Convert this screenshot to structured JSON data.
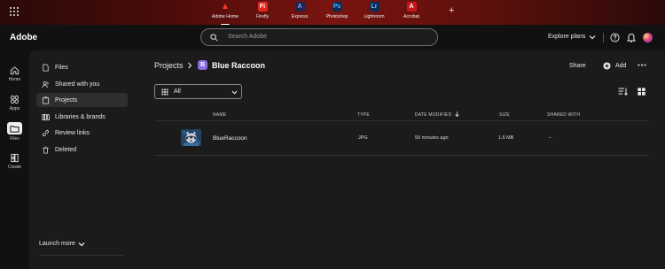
{
  "topbar": {
    "apps": [
      {
        "label": "Adobe Home",
        "glyph": "A",
        "color": "#e0271c",
        "active": true
      },
      {
        "label": "Firefly",
        "glyph": "Fi",
        "color": "#e0271c",
        "active": false
      },
      {
        "label": "Express",
        "glyph": "A",
        "color": "#2c2c6e",
        "active": false
      },
      {
        "label": "Photoshop",
        "glyph": "Ps",
        "color": "#0d2a4f",
        "active": false
      },
      {
        "label": "Lightroom",
        "glyph": "Lr",
        "color": "#0c2d55",
        "active": false
      },
      {
        "label": "Acrobat",
        "glyph": "A",
        "color": "#c8161b",
        "active": false
      }
    ],
    "add_app": "+"
  },
  "header": {
    "brand": "Adobe",
    "search_placeholder": "Search Adobe",
    "explore": "Explore plans"
  },
  "rail": [
    {
      "label": "Home",
      "icon": "home-icon"
    },
    {
      "label": "Apps",
      "icon": "apps-icon"
    },
    {
      "label": "Files",
      "icon": "folder-icon",
      "active": true
    },
    {
      "label": "Create",
      "icon": "create-icon"
    }
  ],
  "nav": {
    "items": [
      {
        "label": "Files",
        "icon": "file-icon"
      },
      {
        "label": "Shared with you",
        "icon": "shared-icon"
      },
      {
        "label": "Projects",
        "icon": "project-icon",
        "active": true
      },
      {
        "label": "Libraries & brands",
        "icon": "library-icon"
      },
      {
        "label": "Review links",
        "icon": "link-icon"
      },
      {
        "label": "Deleted",
        "icon": "trash-icon"
      }
    ],
    "launch_more": "Launch more"
  },
  "breadcrumb": {
    "parent": "Projects",
    "badge": "B",
    "title": "Blue Raccoon"
  },
  "actions": {
    "share": "Share",
    "add": "Add"
  },
  "filter": {
    "value": "All"
  },
  "table": {
    "columns": [
      "NAME",
      "TYPE",
      "DATE MODIFIED",
      "SIZE",
      "SHARED WITH"
    ],
    "rows": [
      {
        "name": "BlueRaccoon",
        "type": "JPG",
        "modified": "50 minutes ago",
        "size": "1.6 MB",
        "shared": "–"
      }
    ]
  },
  "colors": {
    "accent_badge": "#8a6ee0",
    "panel": "#1b1b1b",
    "background": "#111111"
  }
}
